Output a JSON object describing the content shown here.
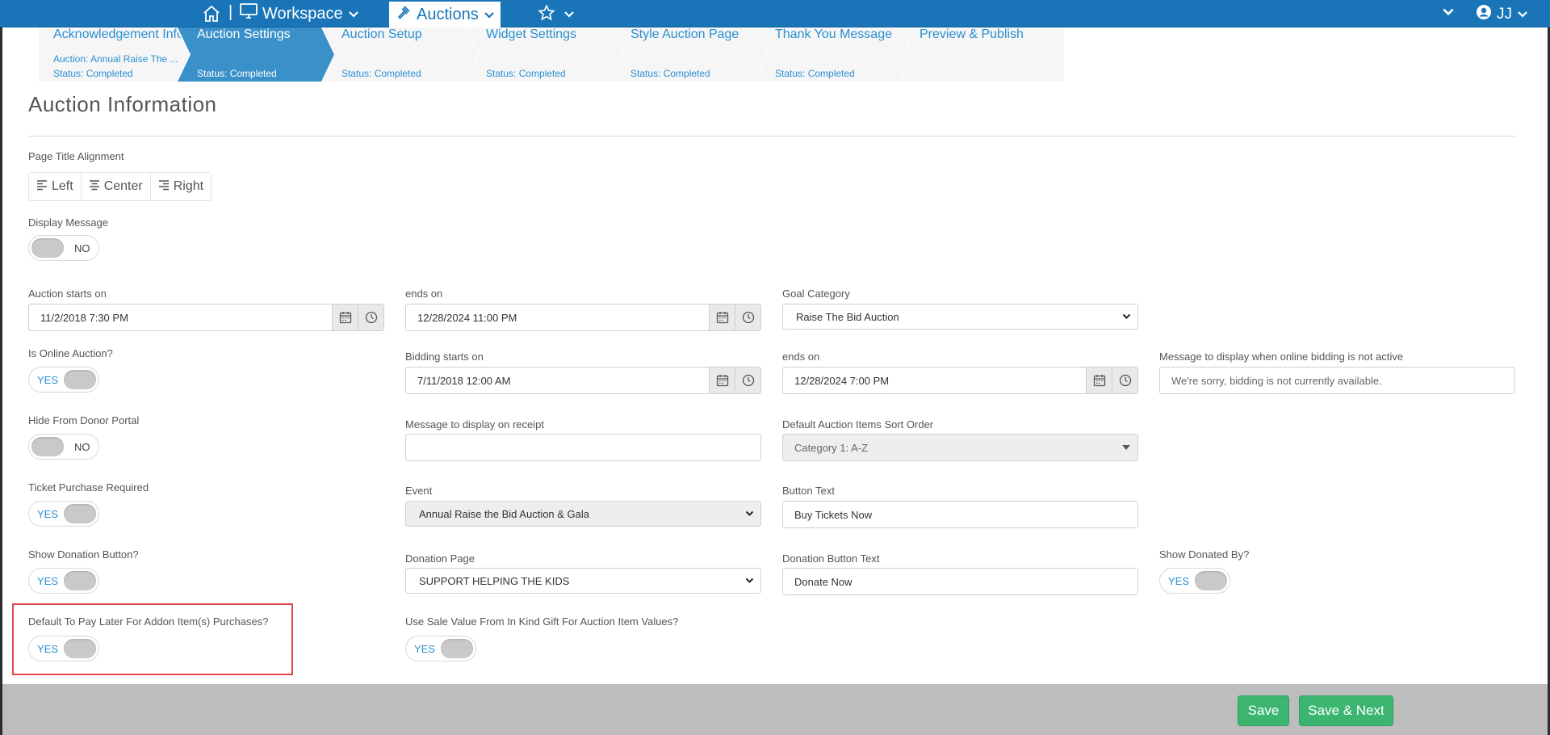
{
  "topbar": {
    "separator": "|",
    "workspace_label": "Workspace",
    "auctions_label": "Auctions",
    "user_initials": "JJ",
    "brand_color": "#1a75b8"
  },
  "steps": [
    {
      "title": "Acknowledgement Info",
      "sub": "Auction: Annual Raise The ...",
      "status": "Status: Completed",
      "active": false
    },
    {
      "title": "Auction Settings",
      "sub": "",
      "status": "Status: Completed",
      "active": true
    },
    {
      "title": "Auction Setup",
      "sub": "",
      "status": "Status: Completed",
      "active": false
    },
    {
      "title": "Widget Settings",
      "sub": "",
      "status": "Status: Completed",
      "active": false
    },
    {
      "title": "Style Auction Page",
      "sub": "",
      "status": "Status: Completed",
      "active": false
    },
    {
      "title": "Thank You Message",
      "sub": "",
      "status": "Status: Completed",
      "active": false
    },
    {
      "title": "Preview & Publish",
      "sub": "",
      "status": "",
      "active": false
    }
  ],
  "section_title": "Auction Information",
  "page_title_alignment": {
    "label": "Page Title Alignment",
    "left": "Left",
    "center": "Center",
    "right": "Right"
  },
  "display_message": {
    "label": "Display Message",
    "value": "NO"
  },
  "auction_starts": {
    "label": "Auction starts on",
    "value": "11/2/2018 7:30 PM"
  },
  "auction_ends": {
    "label": "ends on",
    "value": "12/28/2024 11:00 PM"
  },
  "goal_category": {
    "label": "Goal Category",
    "value": "Raise The Bid Auction"
  },
  "is_online_auction": {
    "label": "Is Online Auction?",
    "value": "YES"
  },
  "bidding_starts": {
    "label": "Bidding starts on",
    "value": "7/11/2018 12:00 AM"
  },
  "bidding_ends": {
    "label": "ends on",
    "value": "12/28/2024 7:00 PM"
  },
  "inactive_message": {
    "label": "Message to display when online bidding is not active",
    "placeholder": "We're sorry, bidding is not currently available."
  },
  "hide_from_donor_portal": {
    "label": "Hide From Donor Portal",
    "value": "NO"
  },
  "receipt_message": {
    "label": "Message to display on receipt",
    "value": ""
  },
  "sort_order": {
    "label": "Default Auction Items Sort Order",
    "value": "Category 1: A-Z"
  },
  "ticket_purchase_required": {
    "label": "Ticket Purchase Required",
    "value": "YES"
  },
  "event": {
    "label": "Event",
    "value": "Annual Raise the Bid Auction & Gala"
  },
  "button_text": {
    "label": "Button Text",
    "value": "Buy Tickets Now"
  },
  "show_donation_button": {
    "label": "Show Donation Button?",
    "value": "YES"
  },
  "donation_page": {
    "label": "Donation Page",
    "value": "SUPPORT HELPING THE KIDS"
  },
  "donation_button_text": {
    "label": "Donation Button Text",
    "value": "Donate Now"
  },
  "show_donated_by": {
    "label": "Show Donated By?",
    "value": "YES"
  },
  "pay_later": {
    "label": "Default To Pay Later For Addon Item(s) Purchases?",
    "value": "YES"
  },
  "sale_value_in_kind": {
    "label": "Use Sale Value From In Kind Gift For Auction Item Values?",
    "value": "YES"
  },
  "footer": {
    "save": "Save",
    "save_next": "Save & Next",
    "button_color": "#3bb56f"
  }
}
